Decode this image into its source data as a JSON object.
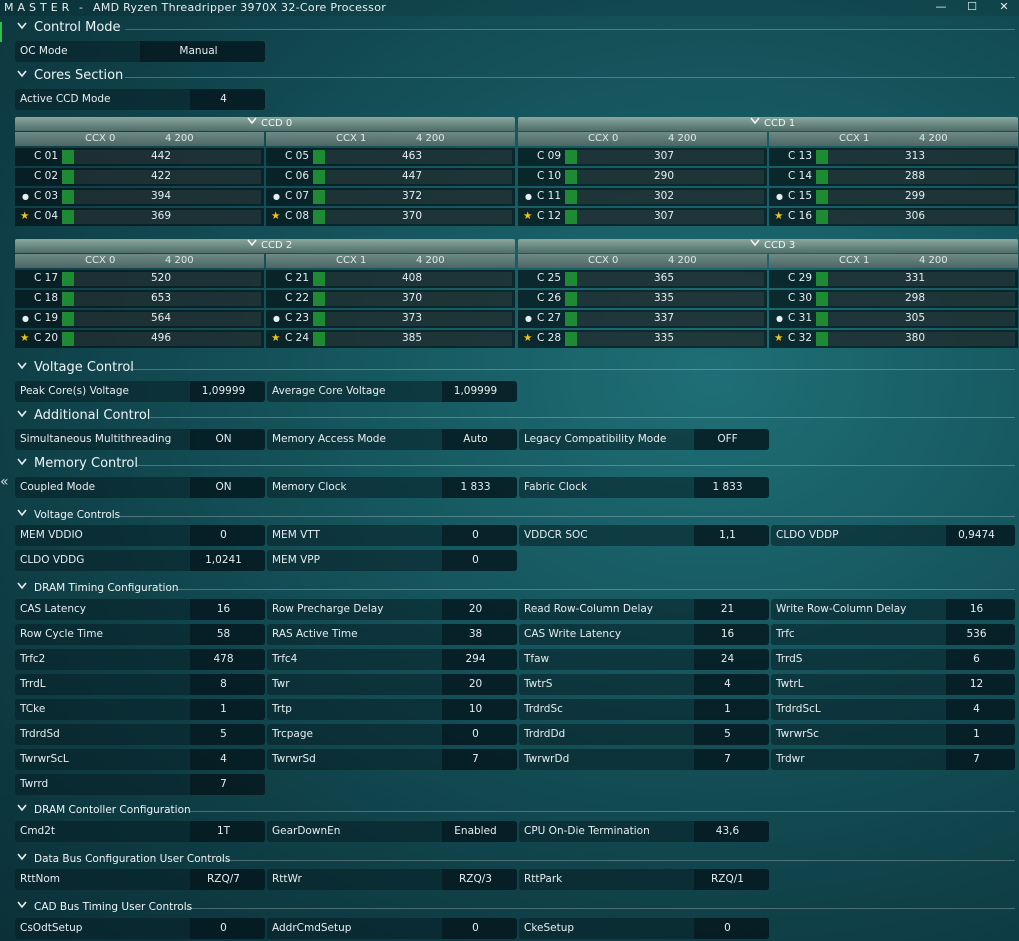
{
  "titlebar": {
    "app": "MASTER",
    "sep": "-",
    "processor": "AMD Ryzen Threadripper 3970X 32-Core Processor",
    "min": "—",
    "max": "☐",
    "close": "✕"
  },
  "collapse_glyph": "«",
  "sections": {
    "control_mode": "Control Mode",
    "cores": "Cores Section",
    "voltage": "Voltage Control",
    "additional": "Additional Control",
    "memory": "Memory Control",
    "voltage_controls": "Voltage Controls",
    "dram_timing": "DRAM Timing Configuration",
    "dram_controller": "DRAM Contoller Configuration",
    "data_bus": "Data Bus Configuration User Controls",
    "cad_bus": "CAD Bus Timing User Controls"
  },
  "oc_mode": {
    "label": "OC Mode",
    "value": "Manual"
  },
  "active_ccd": {
    "label": "Active CCD Mode",
    "value": "4"
  },
  "ccds": [
    {
      "name": "CCD 0",
      "ccx": [
        {
          "name": "CCX 0",
          "freq": "4 200",
          "cores": [
            {
              "label": "C 01",
              "value": "442",
              "mark": ""
            },
            {
              "label": "C 02",
              "value": "422",
              "mark": ""
            },
            {
              "label": "C 03",
              "value": "394",
              "mark": "●"
            },
            {
              "label": "C 04",
              "value": "369",
              "mark": "★"
            }
          ]
        },
        {
          "name": "CCX 1",
          "freq": "4 200",
          "cores": [
            {
              "label": "C 05",
              "value": "463",
              "mark": ""
            },
            {
              "label": "C 06",
              "value": "447",
              "mark": ""
            },
            {
              "label": "C 07",
              "value": "372",
              "mark": "●"
            },
            {
              "label": "C 08",
              "value": "370",
              "mark": "★"
            }
          ]
        }
      ]
    },
    {
      "name": "CCD 1",
      "ccx": [
        {
          "name": "CCX 0",
          "freq": "4 200",
          "cores": [
            {
              "label": "C 09",
              "value": "307",
              "mark": ""
            },
            {
              "label": "C 10",
              "value": "290",
              "mark": ""
            },
            {
              "label": "C 11",
              "value": "302",
              "mark": "●"
            },
            {
              "label": "C 12",
              "value": "307",
              "mark": "★"
            }
          ]
        },
        {
          "name": "CCX 1",
          "freq": "4 200",
          "cores": [
            {
              "label": "C 13",
              "value": "313",
              "mark": ""
            },
            {
              "label": "C 14",
              "value": "288",
              "mark": ""
            },
            {
              "label": "C 15",
              "value": "299",
              "mark": "●"
            },
            {
              "label": "C 16",
              "value": "306",
              "mark": "★"
            }
          ]
        }
      ]
    },
    {
      "name": "CCD 2",
      "ccx": [
        {
          "name": "CCX 0",
          "freq": "4 200",
          "cores": [
            {
              "label": "C 17",
              "value": "520",
              "mark": ""
            },
            {
              "label": "C 18",
              "value": "653",
              "mark": ""
            },
            {
              "label": "C 19",
              "value": "564",
              "mark": "●"
            },
            {
              "label": "C 20",
              "value": "496",
              "mark": "★"
            }
          ]
        },
        {
          "name": "CCX 1",
          "freq": "4 200",
          "cores": [
            {
              "label": "C 21",
              "value": "408",
              "mark": ""
            },
            {
              "label": "C 22",
              "value": "370",
              "mark": ""
            },
            {
              "label": "C 23",
              "value": "373",
              "mark": "●"
            },
            {
              "label": "C 24",
              "value": "385",
              "mark": "★"
            }
          ]
        }
      ]
    },
    {
      "name": "CCD 3",
      "ccx": [
        {
          "name": "CCX 0",
          "freq": "4 200",
          "cores": [
            {
              "label": "C 25",
              "value": "365",
              "mark": ""
            },
            {
              "label": "C 26",
              "value": "335",
              "mark": ""
            },
            {
              "label": "C 27",
              "value": "337",
              "mark": "●"
            },
            {
              "label": "C 28",
              "value": "335",
              "mark": "★"
            }
          ]
        },
        {
          "name": "CCX 1",
          "freq": "4 200",
          "cores": [
            {
              "label": "C 29",
              "value": "331",
              "mark": ""
            },
            {
              "label": "C 30",
              "value": "298",
              "mark": ""
            },
            {
              "label": "C 31",
              "value": "305",
              "mark": "●"
            },
            {
              "label": "C 32",
              "value": "380",
              "mark": "★"
            }
          ]
        }
      ]
    }
  ],
  "voltage_rows": [
    [
      {
        "label": "Peak Core(s) Voltage",
        "value": "1,09999"
      },
      {
        "label": "Average Core Voltage",
        "value": "1,09999"
      }
    ]
  ],
  "additional_rows": [
    [
      {
        "label": "Simultaneous Multithreading",
        "value": "ON"
      },
      {
        "label": "Memory Access Mode",
        "value": "Auto"
      },
      {
        "label": "Legacy Compatibility Mode",
        "value": "OFF"
      }
    ]
  ],
  "memory_rows": [
    [
      {
        "label": "Coupled Mode",
        "value": "ON"
      },
      {
        "label": "Memory Clock",
        "value": "1 833"
      },
      {
        "label": "Fabric Clock",
        "value": "1 833"
      }
    ]
  ],
  "voltage_controls_rows": [
    [
      {
        "label": "MEM VDDIO",
        "value": "0"
      },
      {
        "label": "MEM VTT",
        "value": "0"
      },
      {
        "label": "VDDCR SOC",
        "value": "1,1"
      },
      {
        "label": "CLDO VDDP",
        "value": "0,9474"
      }
    ],
    [
      {
        "label": "CLDO VDDG",
        "value": "1,0241"
      },
      {
        "label": "MEM VPP",
        "value": "0"
      }
    ]
  ],
  "dram_timing_rows": [
    [
      {
        "label": "CAS Latency",
        "value": "16"
      },
      {
        "label": "Row Precharge Delay",
        "value": "20"
      },
      {
        "label": "Read Row-Column Delay",
        "value": "21"
      },
      {
        "label": "Write Row-Column Delay",
        "value": "16"
      }
    ],
    [
      {
        "label": "Row Cycle Time",
        "value": "58"
      },
      {
        "label": "RAS Active Time",
        "value": "38"
      },
      {
        "label": "CAS Write Latency",
        "value": "16"
      },
      {
        "label": "Trfc",
        "value": "536"
      }
    ],
    [
      {
        "label": "Trfc2",
        "value": "478"
      },
      {
        "label": "Trfc4",
        "value": "294"
      },
      {
        "label": "Tfaw",
        "value": "24"
      },
      {
        "label": "TrrdS",
        "value": "6"
      }
    ],
    [
      {
        "label": "TrrdL",
        "value": "8"
      },
      {
        "label": "Twr",
        "value": "20"
      },
      {
        "label": "TwtrS",
        "value": "4"
      },
      {
        "label": "TwtrL",
        "value": "12"
      }
    ],
    [
      {
        "label": "TCke",
        "value": "1"
      },
      {
        "label": "Trtp",
        "value": "10"
      },
      {
        "label": "TrdrdSc",
        "value": "1"
      },
      {
        "label": "TrdrdScL",
        "value": "4"
      }
    ],
    [
      {
        "label": "TrdrdSd",
        "value": "5"
      },
      {
        "label": "Trcpage",
        "value": "0"
      },
      {
        "label": "TrdrdDd",
        "value": "5"
      },
      {
        "label": "TwrwrSc",
        "value": "1"
      }
    ],
    [
      {
        "label": "TwrwrScL",
        "value": "4"
      },
      {
        "label": "TwrwrSd",
        "value": "7"
      },
      {
        "label": "TwrwrDd",
        "value": "7"
      },
      {
        "label": "Trdwr",
        "value": "7"
      }
    ],
    [
      {
        "label": "Twrrd",
        "value": "7"
      }
    ]
  ],
  "dram_controller_rows": [
    [
      {
        "label": "Cmd2t",
        "value": "1T"
      },
      {
        "label": "GearDownEn",
        "value": "Enabled"
      },
      {
        "label": "CPU On-Die Termination",
        "value": "43,6"
      }
    ]
  ],
  "data_bus_rows": [
    [
      {
        "label": "RttNom",
        "value": "RZQ/7"
      },
      {
        "label": "RttWr",
        "value": "RZQ/3"
      },
      {
        "label": "RttPark",
        "value": "RZQ/1"
      }
    ]
  ],
  "cad_bus_rows": [
    [
      {
        "label": "CsOdtSetup",
        "value": "0"
      },
      {
        "label": "AddrCmdSetup",
        "value": "0"
      },
      {
        "label": "CkeSetup",
        "value": "0"
      }
    ]
  ],
  "colors": {
    "accent_green": "#1f8a34",
    "star": "#f0c419",
    "bg": "#16575f"
  }
}
